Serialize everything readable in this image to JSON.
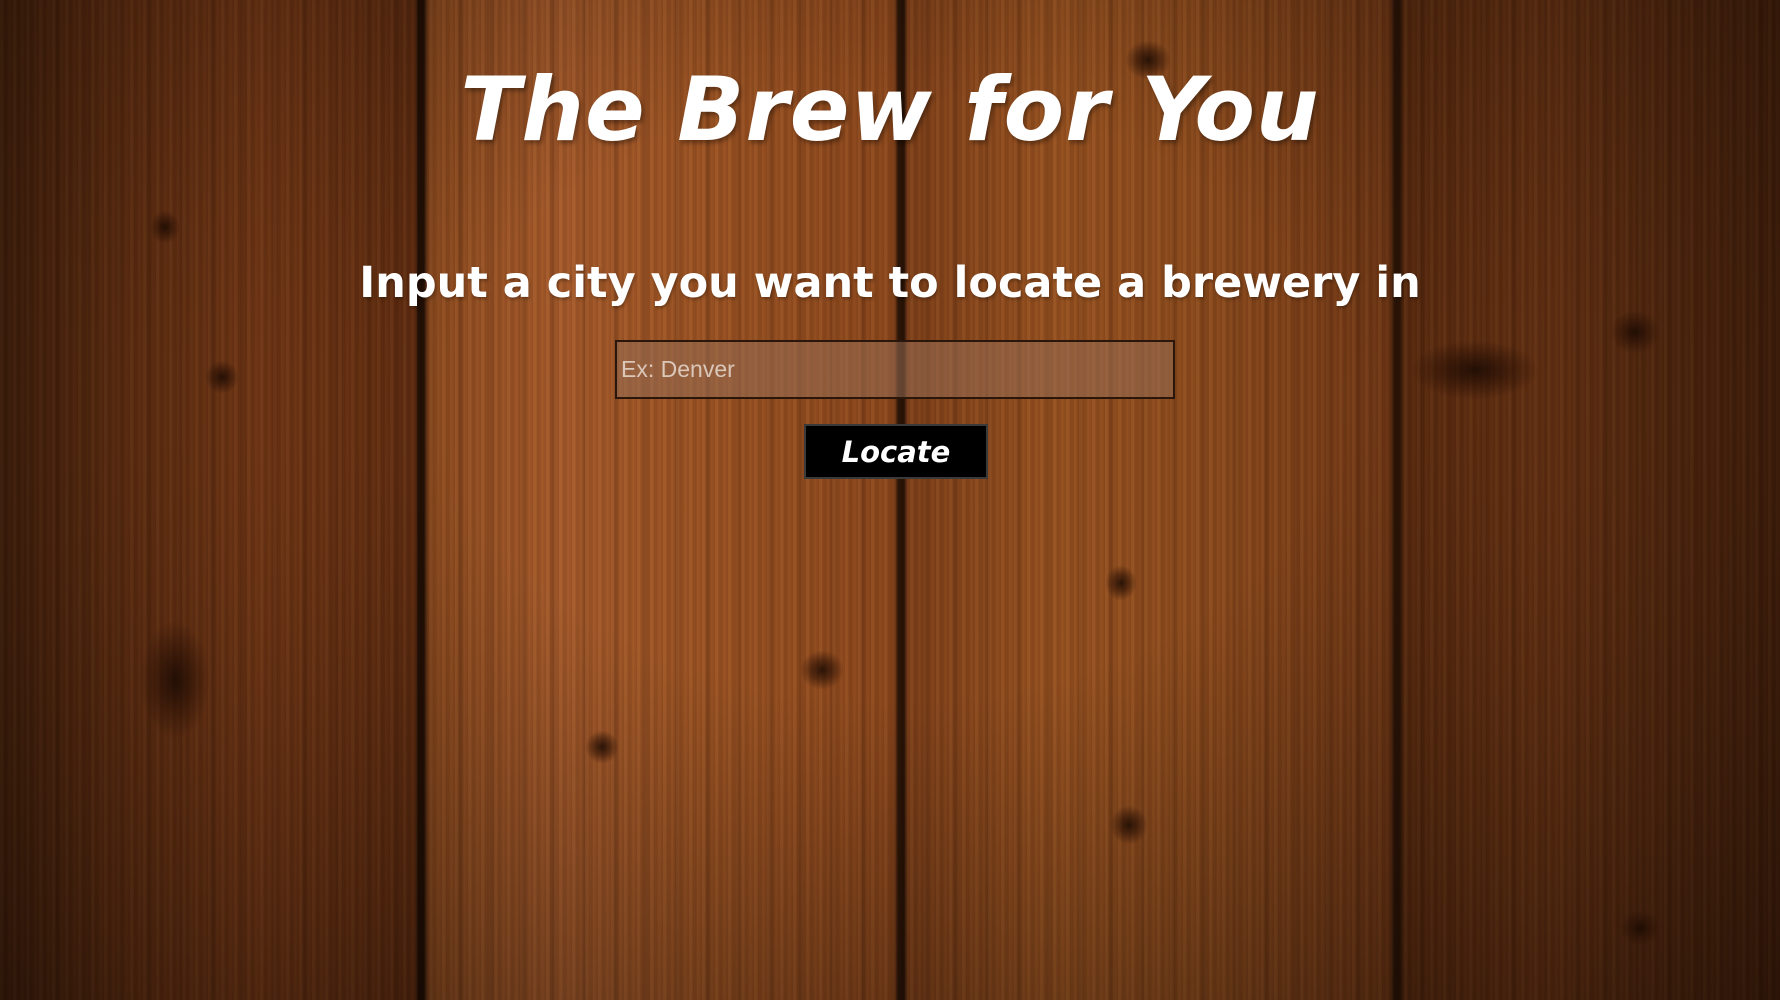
{
  "header": {
    "title": "The Brew for You"
  },
  "search": {
    "prompt": "Input a city you want to locate a brewery in",
    "placeholder": "Ex: Denver",
    "value": "",
    "button_label": "Locate"
  },
  "colors": {
    "text": "#ffffff",
    "button_background": "#000000",
    "background_wood": "#8a461b"
  }
}
